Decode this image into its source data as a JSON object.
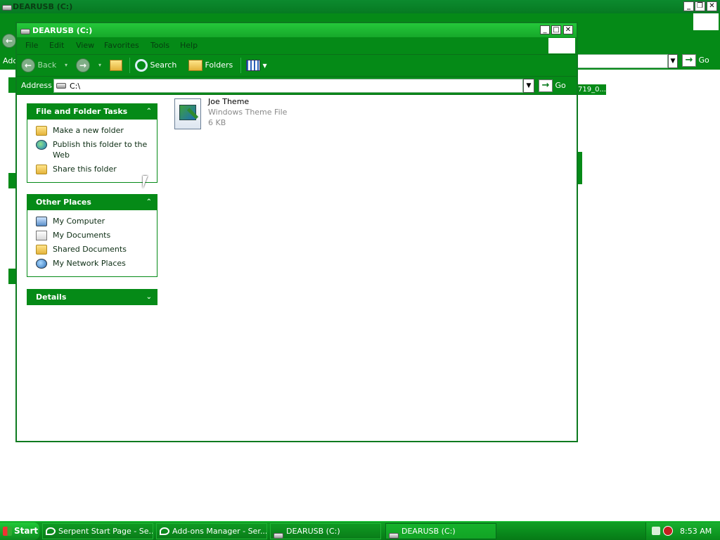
{
  "background_window": {
    "title": "DEARUSB (C:)",
    "address_label": "Add",
    "go_label": "Go",
    "partial_text": "719_0..."
  },
  "window": {
    "title": "DEARUSB (C:)",
    "menu": [
      "File",
      "Edit",
      "View",
      "Favorites",
      "Tools",
      "Help"
    ],
    "toolbar": {
      "back": "Back",
      "search": "Search",
      "folders": "Folders"
    },
    "address": {
      "label": "Address",
      "value": "C:\\",
      "go": "Go"
    }
  },
  "tasks_panel": {
    "title": "File and Folder Tasks",
    "items": [
      {
        "label": "Make a new folder",
        "icon": "new-folder-icon"
      },
      {
        "label": "Publish this folder to the Web",
        "icon": "publish-web-icon"
      },
      {
        "label": "Share this folder",
        "icon": "share-folder-icon"
      }
    ]
  },
  "places_panel": {
    "title": "Other Places",
    "items": [
      {
        "label": "My Computer",
        "icon": "my-computer-icon"
      },
      {
        "label": "My Documents",
        "icon": "my-documents-icon"
      },
      {
        "label": "Shared Documents",
        "icon": "shared-documents-icon"
      },
      {
        "label": "My Network Places",
        "icon": "network-places-icon"
      }
    ]
  },
  "details_panel": {
    "title": "Details"
  },
  "files": [
    {
      "name": "Joe Theme",
      "type": "Windows Theme File",
      "size": "6 KB",
      "icon": "theme-file-icon"
    }
  ],
  "taskbar": {
    "start": "Start",
    "buttons": [
      {
        "label": "Serpent Start Page - Se...",
        "active": false
      },
      {
        "label": "Add-ons Manager - Ser...",
        "active": false
      },
      {
        "label": "DEARUSB (C:)",
        "active": false
      },
      {
        "label": "DEARUSB (C:)",
        "active": true
      }
    ],
    "clock": "8:53 AM"
  },
  "colors": {
    "theme_green": "#058a17",
    "title_green": "#16a82a",
    "content_bg": "#ffffff"
  }
}
